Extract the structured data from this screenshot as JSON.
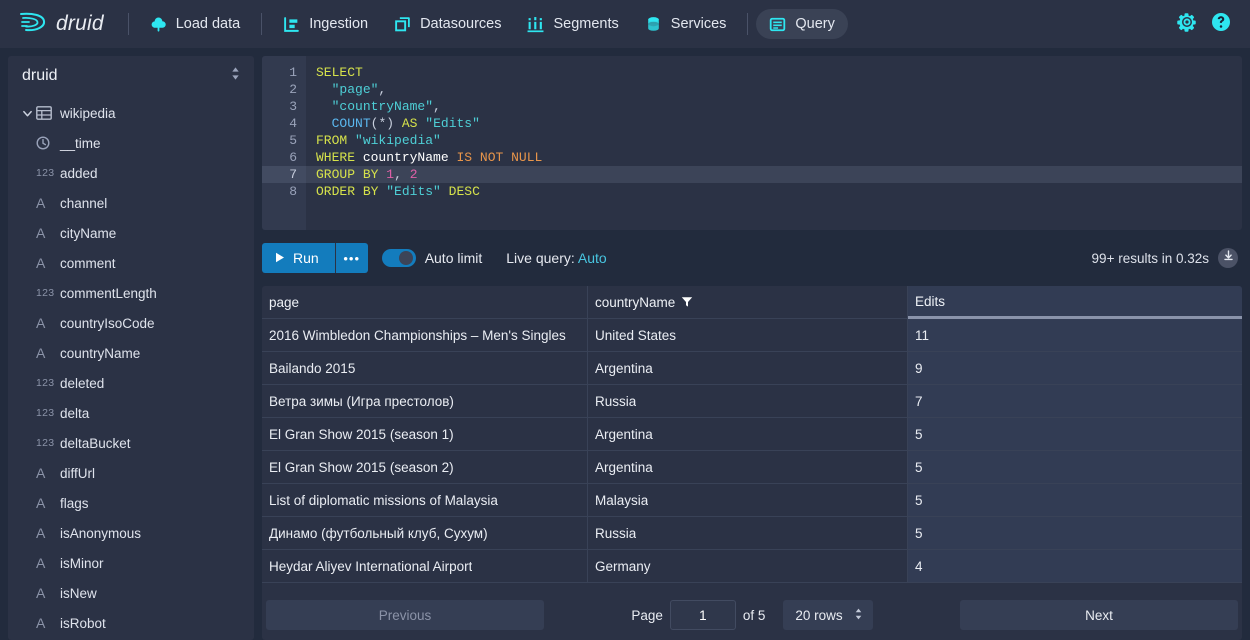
{
  "navbar": {
    "brand": "druid",
    "items": [
      {
        "label": "Load data",
        "icon": "cloud-upload-icon",
        "active": false
      },
      {
        "label": "Ingestion",
        "icon": "ingestion-icon",
        "active": false
      },
      {
        "label": "Datasources",
        "icon": "datasources-icon",
        "active": false
      },
      {
        "label": "Segments",
        "icon": "segments-icon",
        "active": false
      },
      {
        "label": "Services",
        "icon": "services-database-icon",
        "active": false
      },
      {
        "label": "Query",
        "icon": "query-console-icon",
        "active": true
      }
    ],
    "settings_label": "gear-icon",
    "help_label": "help-icon"
  },
  "sidebar": {
    "datasource_selector": "druid",
    "table": {
      "label": "wikipedia",
      "icon": "table-icon",
      "expanded": true
    },
    "columns": [
      {
        "label": "__time",
        "type": "time"
      },
      {
        "label": "added",
        "type": "123"
      },
      {
        "label": "channel",
        "type": "A"
      },
      {
        "label": "cityName",
        "type": "A"
      },
      {
        "label": "comment",
        "type": "A"
      },
      {
        "label": "commentLength",
        "type": "123"
      },
      {
        "label": "countryIsoCode",
        "type": "A"
      },
      {
        "label": "countryName",
        "type": "A"
      },
      {
        "label": "deleted",
        "type": "123"
      },
      {
        "label": "delta",
        "type": "123"
      },
      {
        "label": "deltaBucket",
        "type": "123"
      },
      {
        "label": "diffUrl",
        "type": "A"
      },
      {
        "label": "flags",
        "type": "A"
      },
      {
        "label": "isAnonymous",
        "type": "A"
      },
      {
        "label": "isMinor",
        "type": "A"
      },
      {
        "label": "isNew",
        "type": "A"
      },
      {
        "label": "isRobot",
        "type": "A"
      }
    ]
  },
  "editor": {
    "active_line": 7,
    "lines": [
      {
        "n": "1",
        "text": "SELECT"
      },
      {
        "n": "2",
        "text": "  \"page\","
      },
      {
        "n": "3",
        "text": "  \"countryName\","
      },
      {
        "n": "4",
        "text": "  COUNT(*) AS \"Edits\""
      },
      {
        "n": "5",
        "text": "FROM \"wikipedia\""
      },
      {
        "n": "6",
        "text": "WHERE countryName IS NOT NULL"
      },
      {
        "n": "7",
        "text": "GROUP BY 1, 2"
      },
      {
        "n": "8",
        "text": "ORDER BY \"Edits\" DESC"
      }
    ]
  },
  "toolbar": {
    "run_label": "Run",
    "more_label": "•••",
    "auto_limit_label": "Auto limit",
    "auto_limit_on": true,
    "live_query_label": "Live query:",
    "live_query_value": "Auto",
    "results_status": "99+ results in 0.32s",
    "download_icon": "download-icon"
  },
  "results": {
    "columns": [
      {
        "label": "page",
        "filtered": false,
        "sorted": false
      },
      {
        "label": "countryName",
        "filtered": true,
        "sorted": false
      },
      {
        "label": "Edits",
        "filtered": false,
        "sorted": true
      }
    ],
    "rows": [
      {
        "page": "2016 Wimbledon Championships – Men's Singles",
        "countryName": "United States",
        "edits": "11"
      },
      {
        "page": "Bailando 2015",
        "countryName": "Argentina",
        "edits": "9"
      },
      {
        "page": "Ветра зимы (Игра престолов)",
        "countryName": "Russia",
        "edits": "7"
      },
      {
        "page": "El Gran Show 2015 (season 1)",
        "countryName": "Argentina",
        "edits": "5"
      },
      {
        "page": "El Gran Show 2015 (season 2)",
        "countryName": "Argentina",
        "edits": "5"
      },
      {
        "page": "List of diplomatic missions of Malaysia",
        "countryName": "Malaysia",
        "edits": "5"
      },
      {
        "page": "Динамо (футбольный клуб, Сухум)",
        "countryName": "Russia",
        "edits": "5"
      },
      {
        "page": "Heydar Aliyev International Airport",
        "countryName": "Germany",
        "edits": "4"
      }
    ]
  },
  "pagination": {
    "previous_label": "Previous",
    "page_label": "Page",
    "page_value": "1",
    "of_label": "of 5",
    "rows_per_page": "20 rows",
    "next_label": "Next"
  },
  "colors": {
    "accent": "#2ee6f0",
    "primary_button": "#137cbd",
    "link": "#48c5e0",
    "panel": "#2b3245",
    "app_bg": "#222b3d"
  }
}
